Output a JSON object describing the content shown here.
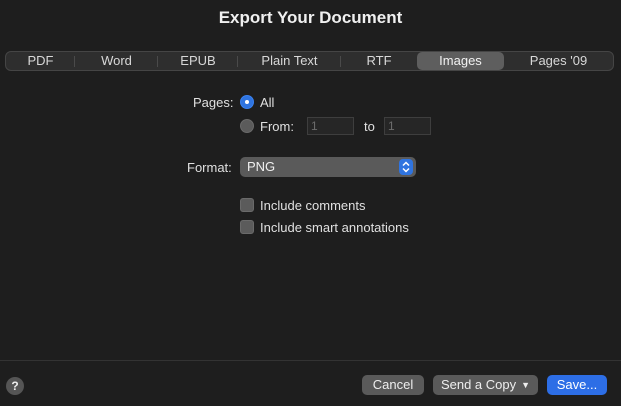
{
  "dialog": {
    "title": "Export Your Document"
  },
  "tabs": [
    {
      "label": "PDF",
      "active": false
    },
    {
      "label": "Word",
      "active": false
    },
    {
      "label": "EPUB",
      "active": false
    },
    {
      "label": "Plain Text",
      "active": false
    },
    {
      "label": "RTF",
      "active": false
    },
    {
      "label": "Images",
      "active": true
    },
    {
      "label": "Pages '09",
      "active": false
    }
  ],
  "pages": {
    "label": "Pages:",
    "all_label": "All",
    "all_selected": true,
    "from_label": "From:",
    "from_value": "1",
    "to_label": "to",
    "to_value": "1"
  },
  "format": {
    "label": "Format:",
    "value": "PNG"
  },
  "options": {
    "include_comments": {
      "label": "Include comments",
      "checked": false
    },
    "include_smart_annotations": {
      "label": "Include smart annotations",
      "checked": false
    }
  },
  "footer": {
    "help_label": "?",
    "cancel_label": "Cancel",
    "send_copy_label": "Send a Copy",
    "save_label": "Save..."
  },
  "colors": {
    "accent": "#2f74e0",
    "background": "#1e1e1e"
  }
}
